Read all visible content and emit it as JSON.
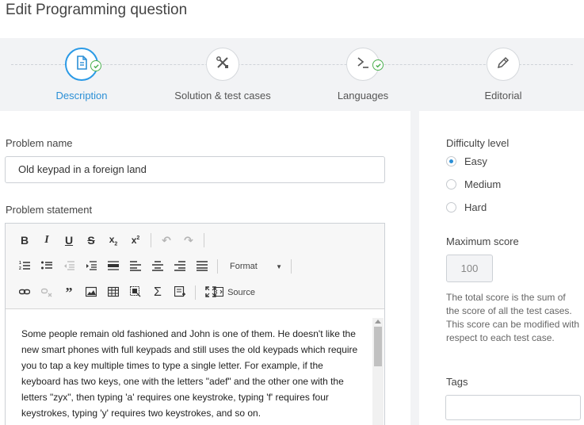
{
  "page": {
    "title": "Edit Programming question"
  },
  "steps": [
    {
      "label": "Description",
      "icon": "document-icon",
      "active": true,
      "completed": true
    },
    {
      "label": "Solution & test cases",
      "icon": "tools-icon",
      "active": false,
      "completed": false
    },
    {
      "label": "Languages",
      "icon": "terminal-icon",
      "active": false,
      "completed": true
    },
    {
      "label": "Editorial",
      "icon": "pencil-icon",
      "active": false,
      "completed": false
    }
  ],
  "problem_name": {
    "label": "Problem name",
    "value": "Old keypad in a foreign land"
  },
  "problem_statement": {
    "label": "Problem statement",
    "toolbar": {
      "format_label": "Format",
      "source_label": "Source"
    },
    "content": "Some people remain old fashioned and John is one of them. He doesn't like the new smart phones with full keypads and still uses the old keypads which require you to tap a key multiple times to type a single letter. For example, if the keyboard has two keys, one with the letters \"adef\" and the other one with the letters \"zyx\", then typing 'a' requires one keystroke, typing 'f' requires four keystrokes, typing 'y' requires two keystrokes, and so on."
  },
  "difficulty": {
    "label": "Difficulty level",
    "options": [
      "Easy",
      "Medium",
      "Hard"
    ],
    "selected": "Easy"
  },
  "max_score": {
    "label": "Maximum score",
    "value": "100",
    "help": "The total score is the sum of the score of all the test cases. This score can be modified with respect to each test case."
  },
  "tags": {
    "label": "Tags",
    "value": ""
  },
  "colors": {
    "accent": "#2b8fd6",
    "success": "#4cb050",
    "panel_bg": "#f2f3f5"
  }
}
